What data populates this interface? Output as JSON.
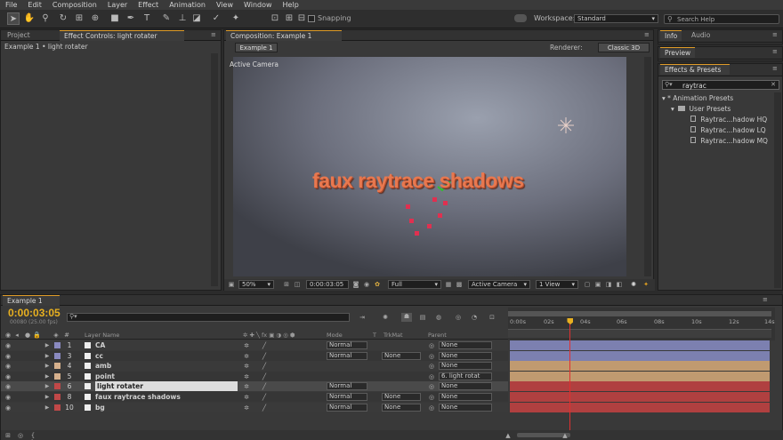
{
  "menu": [
    "File",
    "Edit",
    "Composition",
    "Layer",
    "Effect",
    "Animation",
    "View",
    "Window",
    "Help"
  ],
  "toolbar": {
    "snapping_label": "Snapping",
    "workspace_label": "Workspace:",
    "workspace_value": "Standard",
    "search_placeholder": "Search Help"
  },
  "left_panel": {
    "tab_project": "Project",
    "tab_effect_controls": "Effect Controls: light rotater",
    "breadcrumb": "Example 1 • light rotater"
  },
  "comp_panel": {
    "tab": "Composition: Example 1",
    "subtab": "Example 1",
    "renderer_label": "Renderer:",
    "renderer_value": "Classic 3D",
    "camera_label": "Active Camera",
    "scene_text": "faux raytrace shadows",
    "footer": {
      "zoom": "50%",
      "timecode": "0:00:03:05",
      "resolution": "Full",
      "view": "Active Camera",
      "views": "1 View"
    }
  },
  "right_panel": {
    "tab_info": "Info",
    "tab_audio": "Audio",
    "tab_preview": "Preview",
    "tab_effects": "Effects & Presets",
    "search_value": "raytrac",
    "tree": [
      {
        "label": "Animation Presets",
        "level": 0
      },
      {
        "label": "User Presets",
        "level": 1
      },
      {
        "label": "Raytrac...hadow HQ",
        "level": 2
      },
      {
        "label": "Raytrac...hadow LQ",
        "level": 2
      },
      {
        "label": "Raytrac...hadow MQ",
        "level": 2
      }
    ]
  },
  "timeline": {
    "tab": "Example 1",
    "timecode": "0:00:03:05",
    "frames": "00080 (25.00 fps)",
    "headers": {
      "layer_name": "Layer Name",
      "mode": "Mode",
      "t": "T",
      "trkmat": "TrkMat",
      "parent": "Parent"
    },
    "ruler": [
      "0:00s",
      "02s",
      "04s",
      "06s",
      "08s",
      "10s",
      "12s",
      "14s"
    ],
    "current_time_fraction": 0.228,
    "layers": [
      {
        "num": "1",
        "name": "CA",
        "color": "#8a8ac0",
        "mode": "Normal",
        "trkmat": "",
        "parent": "None",
        "bar": "#7c80b0"
      },
      {
        "num": "3",
        "name": "cc",
        "color": "#8a8ac0",
        "mode": "Normal",
        "trkmat": "None",
        "parent": "None",
        "bar": "#7c80b0"
      },
      {
        "num": "4",
        "name": "amb",
        "color": "#d6b08c",
        "mode": "",
        "trkmat": "",
        "parent": "None",
        "bar": "#c09a70"
      },
      {
        "num": "5",
        "name": "point",
        "color": "#d6b08c",
        "mode": "",
        "trkmat": "",
        "parent": "6. light rotat",
        "bar": "#c09a70"
      },
      {
        "num": "6",
        "name": "light rotater",
        "color": "#c04848",
        "mode": "Normal",
        "trkmat": "",
        "parent": "None",
        "bar": "#b04040",
        "selected": true
      },
      {
        "num": "8",
        "name": "faux raytrace shadows",
        "color": "#c04848",
        "mode": "Normal",
        "trkmat": "None",
        "parent": "None",
        "bar": "#b04040"
      },
      {
        "num": "10",
        "name": "bg",
        "color": "#c04848",
        "mode": "Normal",
        "trkmat": "None",
        "parent": "None",
        "bar": "#b04040"
      }
    ]
  },
  "colors": {
    "accent": "#e0a020",
    "timecode": "#e8b020"
  }
}
